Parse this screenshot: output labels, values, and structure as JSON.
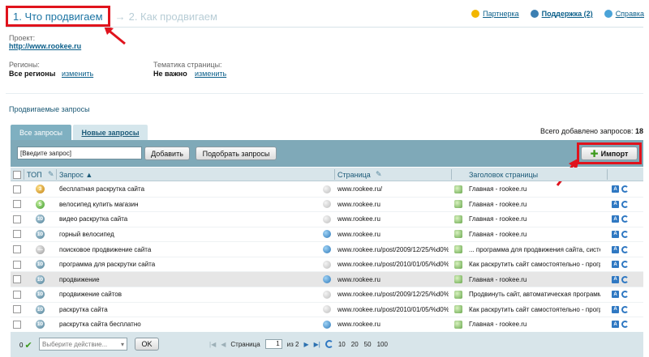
{
  "steps": {
    "step1": "1. Что продвигаем",
    "separator": "→",
    "step2": "2. Как продвигаем"
  },
  "toplinks": [
    {
      "label": "Партнерка",
      "icon": "dollar-icon",
      "color": "#f2b600"
    },
    {
      "label": "Поддержка (2)",
      "icon": "user-icon",
      "color": "#3b7fb2"
    },
    {
      "label": "Справка",
      "icon": "help-icon",
      "color": "#4aa3d8"
    }
  ],
  "project": {
    "label": "Проект:",
    "url": "http://www.rookee.ru"
  },
  "regions": {
    "label": "Регионы:",
    "value": "Все регионы",
    "change": "изменить"
  },
  "theme": {
    "label": "Тематика страницы:",
    "value": "Не важно",
    "change": "изменить"
  },
  "section_title": "Продвигаемые запросы",
  "tabs": {
    "all": "Все запросы",
    "new": "Новые запросы"
  },
  "total": {
    "label": "Всего добавлено запросов:",
    "count": "18"
  },
  "toolbar": {
    "input_value": "[Введите запрос]",
    "add": "Добавить",
    "pick": "Подобрать запросы",
    "import": "Импорт"
  },
  "columns": {
    "top": "ТОП",
    "query": "Запрос ▲",
    "page": "Страница",
    "page_title": "Заголовок страницы"
  },
  "rows": [
    {
      "badge": "3",
      "badge_color": "gold",
      "query": "бесплатная раскрутка сайта",
      "page_icon": "gray",
      "page": "www.rookee.ru/",
      "title": "Главная - rookee.ru"
    },
    {
      "badge": "5",
      "badge_color": "green",
      "query": "велосипед купить магазин",
      "page_icon": "gray",
      "page": "www.rookee.ru",
      "title": "Главная - rookee.ru"
    },
    {
      "badge": "10",
      "badge_color": "blue",
      "query": "видео раскрутка сайта",
      "page_icon": "gray",
      "page": "www.rookee.ru",
      "title": "Главная - rookee.ru"
    },
    {
      "badge": "10",
      "badge_color": "blue",
      "query": "горный велосипед",
      "page_icon": "blue",
      "page": "www.rookee.ru",
      "title": "Главная - rookee.ru"
    },
    {
      "badge": "—",
      "badge_color": "gray",
      "query": "поисковое продвижение сайта",
      "page_icon": "blue",
      "page": "www.rookee.ru/post/2009/12/25/%d0%",
      "title": "... программа для продвижения сайта, систе"
    },
    {
      "badge": "10",
      "badge_color": "blue",
      "query": "программа для раскрутки сайта",
      "page_icon": "gray",
      "page": "www.rookee.ru/post/2010/01/05/%d0%",
      "title": "Как раскрутить сайт самостоятельно - прогр"
    },
    {
      "badge": "10",
      "badge_color": "blue",
      "query": "продвижение",
      "page_icon": "blue",
      "page": "www.rookee.ru",
      "title": "Главная - rookee.ru"
    },
    {
      "badge": "10",
      "badge_color": "blue",
      "query": "продвижение сайтов",
      "page_icon": "gray",
      "page": "www.rookee.ru/post/2009/12/25/%d0%",
      "title": "Продвинуть сайт, автоматическая программ"
    },
    {
      "badge": "10",
      "badge_color": "blue",
      "query": "раскрутка сайта",
      "page_icon": "gray",
      "page": "www.rookee.ru/post/2010/01/05/%d0%",
      "title": "Как раскрутить сайт самостоятельно - прогр"
    },
    {
      "badge": "10",
      "badge_color": "blue",
      "query": "раскрутка сайта бесплатно",
      "page_icon": "blue",
      "page": "www.rookee.ru",
      "title": "Главная - rookee.ru"
    }
  ],
  "footer": {
    "count": "0",
    "select_placeholder": "Выберите действие...",
    "ok": "OK",
    "page_label": "Страница",
    "page_value": "1",
    "of": "из 2",
    "sizes": [
      "10",
      "20",
      "50",
      "100"
    ]
  }
}
